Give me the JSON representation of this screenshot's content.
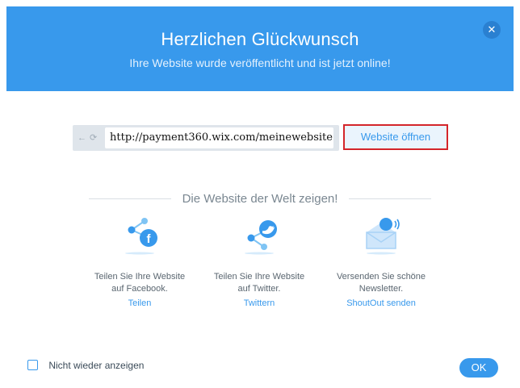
{
  "header": {
    "title": "Herzlichen Glückwunsch",
    "subtitle": "Ihre Website wurde veröffentlicht und ist jetzt online!",
    "close_icon": "close-icon"
  },
  "url_bar": {
    "back_icon": "arrow-left-icon",
    "refresh_icon": "refresh-icon",
    "url": "http://payment360.wix.com/meinewebsite"
  },
  "open_button": {
    "label": "Website öffnen"
  },
  "section": {
    "title": "Die Website der Welt zeigen!"
  },
  "share_options": [
    {
      "icon": "facebook-share-icon",
      "desc_line1": "Teilen Sie Ihre Website",
      "desc_line2": "auf Facebook.",
      "link": "Teilen"
    },
    {
      "icon": "twitter-share-icon",
      "desc_line1": "Teilen Sie Ihre Website",
      "desc_line2": "auf Twitter.",
      "link": "Twittern"
    },
    {
      "icon": "newsletter-icon",
      "desc_line1": "Versenden Sie schöne",
      "desc_line2": "Newsletter.",
      "link": "ShoutOut senden"
    }
  ],
  "footer": {
    "checkbox_label": "Nicht wieder anzeigen",
    "checkbox_checked": false,
    "ok_label": "OK"
  },
  "colors": {
    "header_bg": "#3899ec",
    "accent": "#3899ec",
    "highlight_border": "#d4252a",
    "facebook": "#3b5998",
    "twitter": "#1da1f2"
  }
}
